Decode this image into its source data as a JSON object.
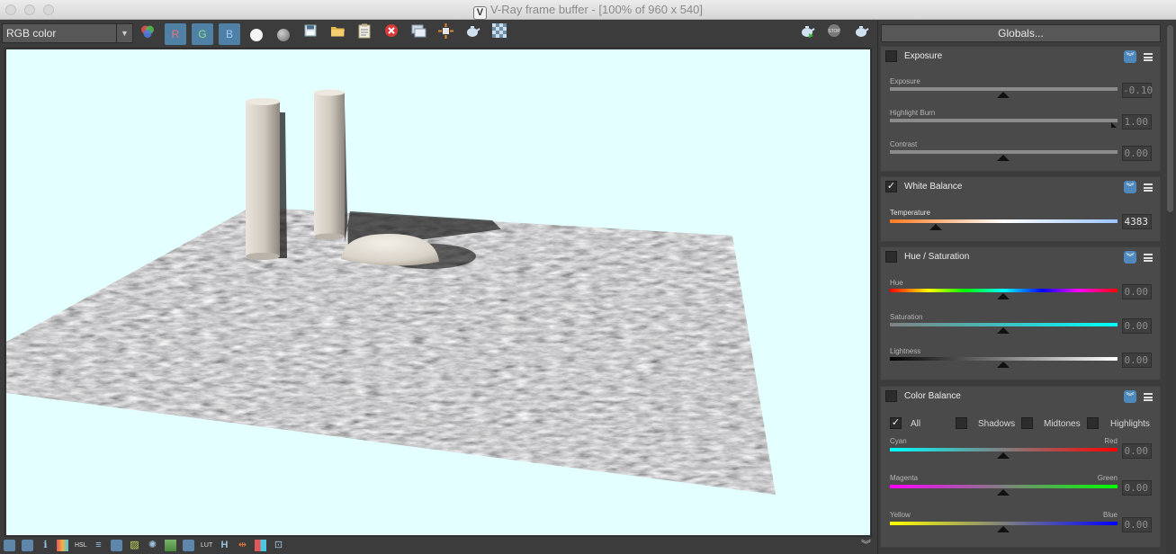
{
  "window": {
    "title": "V-Ray frame buffer - [100% of 960 x 540]",
    "logo_text": "V"
  },
  "toolbar": {
    "channel_select": "RGB color",
    "red_label": "R",
    "green_label": "G",
    "blue_label": "B",
    "icons": [
      "color-channels-icon",
      "red-channel-icon",
      "green-channel-icon",
      "blue-channel-icon",
      "white-dot-icon",
      "gray-dot-icon",
      "save-icon",
      "open-folder-icon",
      "clipboard-icon",
      "clear-icon",
      "duplicate-icon",
      "region-icon",
      "render-teapot-icon",
      "checker-icon",
      "render-interactive-icon",
      "stop-icon",
      "render-icon"
    ]
  },
  "panel": {
    "globals_label": "Globals...",
    "exposure": {
      "title": "Exposure",
      "enabled": false,
      "sliders": [
        {
          "label": "Exposure",
          "value": "-0.10",
          "pos": 0.5
        },
        {
          "label": "Highlight Burn",
          "value": "1.00",
          "pos": 1.0
        },
        {
          "label": "Contrast",
          "value": "0.00",
          "pos": 0.5
        }
      ]
    },
    "white_balance": {
      "title": "White Balance",
      "enabled": true,
      "slider": {
        "label": "Temperature",
        "value": "4383",
        "pos": 0.2
      }
    },
    "hue_saturation": {
      "title": "Hue / Saturation",
      "enabled": false,
      "sliders": [
        {
          "label": "Hue",
          "value": "0.00",
          "pos": 0.5
        },
        {
          "label": "Saturation",
          "value": "0.00",
          "pos": 0.5
        },
        {
          "label": "Lightness",
          "value": "0.00",
          "pos": 0.5
        }
      ]
    },
    "color_balance": {
      "title": "Color Balance",
      "enabled": false,
      "ranges": [
        {
          "label": "All",
          "checked": true
        },
        {
          "label": "Shadows",
          "checked": false
        },
        {
          "label": "Midtones",
          "checked": false
        },
        {
          "label": "Highlights",
          "checked": false
        }
      ],
      "sliders": [
        {
          "left": "Cyan",
          "right": "Red",
          "value": "0.00",
          "pos": 0.5
        },
        {
          "left": "Magenta",
          "right": "Green",
          "value": "0.00",
          "pos": 0.5
        },
        {
          "left": "Yellow",
          "right": "Blue",
          "value": "0.00",
          "pos": 0.5
        }
      ]
    }
  },
  "statusbar": {
    "icons": [
      "track-mouse-icon",
      "copy-icon",
      "info-icon",
      "color-corrections-icon",
      "hsl-icon",
      "levels-icon",
      "display-lut-icon",
      "curves-icon",
      "lens-effects-icon",
      "background-icon",
      "srgb-icon",
      "lut-icon",
      "history-icon",
      "compare-ab-icon",
      "stereo-icon",
      "region-render-icon"
    ],
    "h_label": "H",
    "collapse_icon": "double-chevron-down-icon"
  }
}
